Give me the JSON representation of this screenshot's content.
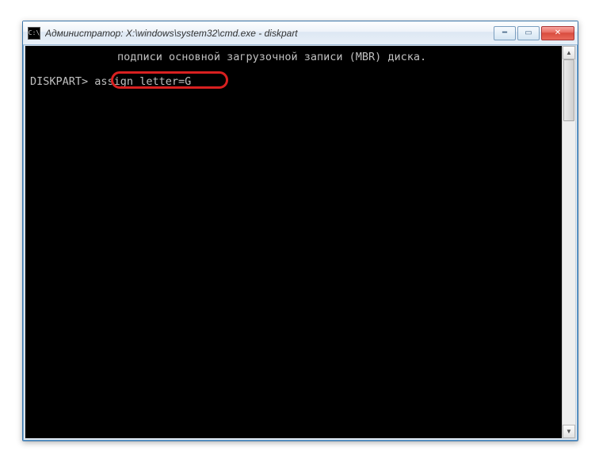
{
  "window": {
    "title": "Администратор: X:\\windows\\system32\\cmd.exe - diskpart",
    "icon_label": "C:\\"
  },
  "controls": {
    "minimize_glyph": "━",
    "maximize_glyph": "▭",
    "close_glyph": "✕"
  },
  "console": {
    "line1": "подписи основной загрузочной записи (MBR) диска.",
    "prompt": "DISKPART>",
    "command": "assign letter=G",
    "cursor": "_"
  }
}
